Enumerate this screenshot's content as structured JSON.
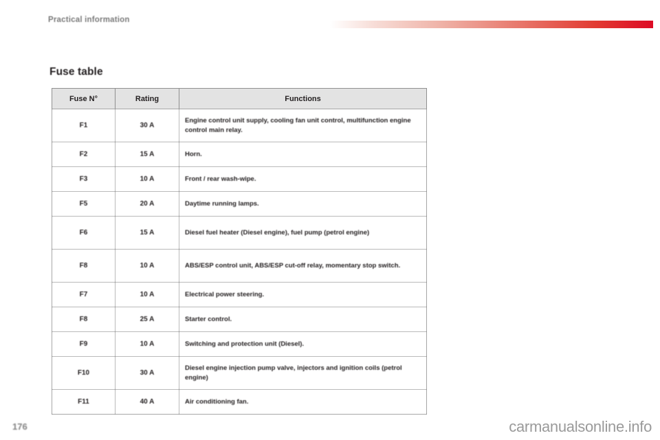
{
  "header": {
    "section": "Practical information",
    "accent_color": "#dd0b25"
  },
  "title": "Fuse table",
  "table": {
    "columns": [
      "Fuse N°",
      "Rating",
      "Functions"
    ],
    "rows": [
      {
        "fuse": "F1",
        "rating": "30 A",
        "functions": "Engine control unit supply, cooling fan unit control, multifunction engine control main relay."
      },
      {
        "fuse": "F2",
        "rating": "15 A",
        "functions": "Horn."
      },
      {
        "fuse": "F3",
        "rating": "10 A",
        "functions": "Front / rear wash-wipe."
      },
      {
        "fuse": "F5",
        "rating": "20 A",
        "functions": "Daytime running lamps."
      },
      {
        "fuse": "F6",
        "rating": "15 A",
        "functions": "Diesel fuel heater (Diesel engine), fuel pump (petrol engine)"
      },
      {
        "fuse": "F8",
        "rating": "10 A",
        "functions": "ABS/ESP control unit, ABS/ESP cut-off relay, momentary stop switch."
      },
      {
        "fuse": "F7",
        "rating": "10 A",
        "functions": "Electrical power steering."
      },
      {
        "fuse": "F8",
        "rating": "25 A",
        "functions": "Starter control."
      },
      {
        "fuse": "F9",
        "rating": "10 A",
        "functions": "Switching and protection unit (Diesel)."
      },
      {
        "fuse": "F10",
        "rating": "30 A",
        "functions": "Diesel engine injection pump valve, injectors and ignition coils (petrol engine)"
      },
      {
        "fuse": "F11",
        "rating": "40 A",
        "functions": "Air conditioning fan."
      }
    ]
  },
  "footer": {
    "page_number": "176",
    "watermark": "carmanualsonline.info"
  }
}
